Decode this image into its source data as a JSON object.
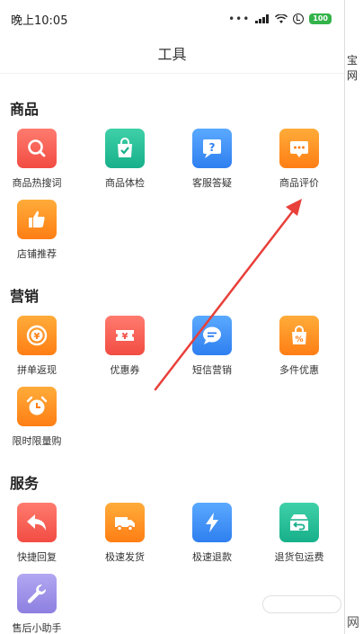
{
  "status_bar": {
    "time": "晚上10:05",
    "battery": "100"
  },
  "navbar": {
    "title": "工具"
  },
  "sections": [
    {
      "title": "商品",
      "tools": [
        {
          "label": "商品热搜词",
          "icon": "search-icon",
          "color": "red"
        },
        {
          "label": "商品体检",
          "icon": "shopping-bag-check-icon",
          "color": "teal"
        },
        {
          "label": "客服答疑",
          "icon": "question-chat-icon",
          "color": "blue"
        },
        {
          "label": "商品评价",
          "icon": "comment-icon",
          "color": "orange"
        },
        {
          "label": "店铺推荐",
          "icon": "thumbs-up-icon",
          "color": "orange"
        }
      ]
    },
    {
      "title": "营销",
      "tools": [
        {
          "label": "拼单返现",
          "icon": "yuan-coin-icon",
          "color": "orange"
        },
        {
          "label": "优惠券",
          "icon": "coupon-icon",
          "color": "red"
        },
        {
          "label": "短信营销",
          "icon": "sms-icon",
          "color": "blue"
        },
        {
          "label": "多件优惠",
          "icon": "percent-bag-icon",
          "color": "orange"
        },
        {
          "label": "限时限量购",
          "icon": "alarm-clock-icon",
          "color": "orange"
        }
      ]
    },
    {
      "title": "服务",
      "tools": [
        {
          "label": "快捷回复",
          "icon": "reply-arrow-icon",
          "color": "red"
        },
        {
          "label": "极速发货",
          "icon": "truck-icon",
          "color": "orange"
        },
        {
          "label": "极速退款",
          "icon": "lightning-icon",
          "color": "blue"
        },
        {
          "label": "退货包运费",
          "icon": "return-box-icon",
          "color": "teal"
        },
        {
          "label": "售后小助手",
          "icon": "wrench-icon",
          "color": "lavender"
        }
      ]
    }
  ],
  "colors": {
    "annotation_arrow": "#e8403a"
  },
  "background_fragments": {
    "right_text": "宝网",
    "corner_text": "网"
  }
}
